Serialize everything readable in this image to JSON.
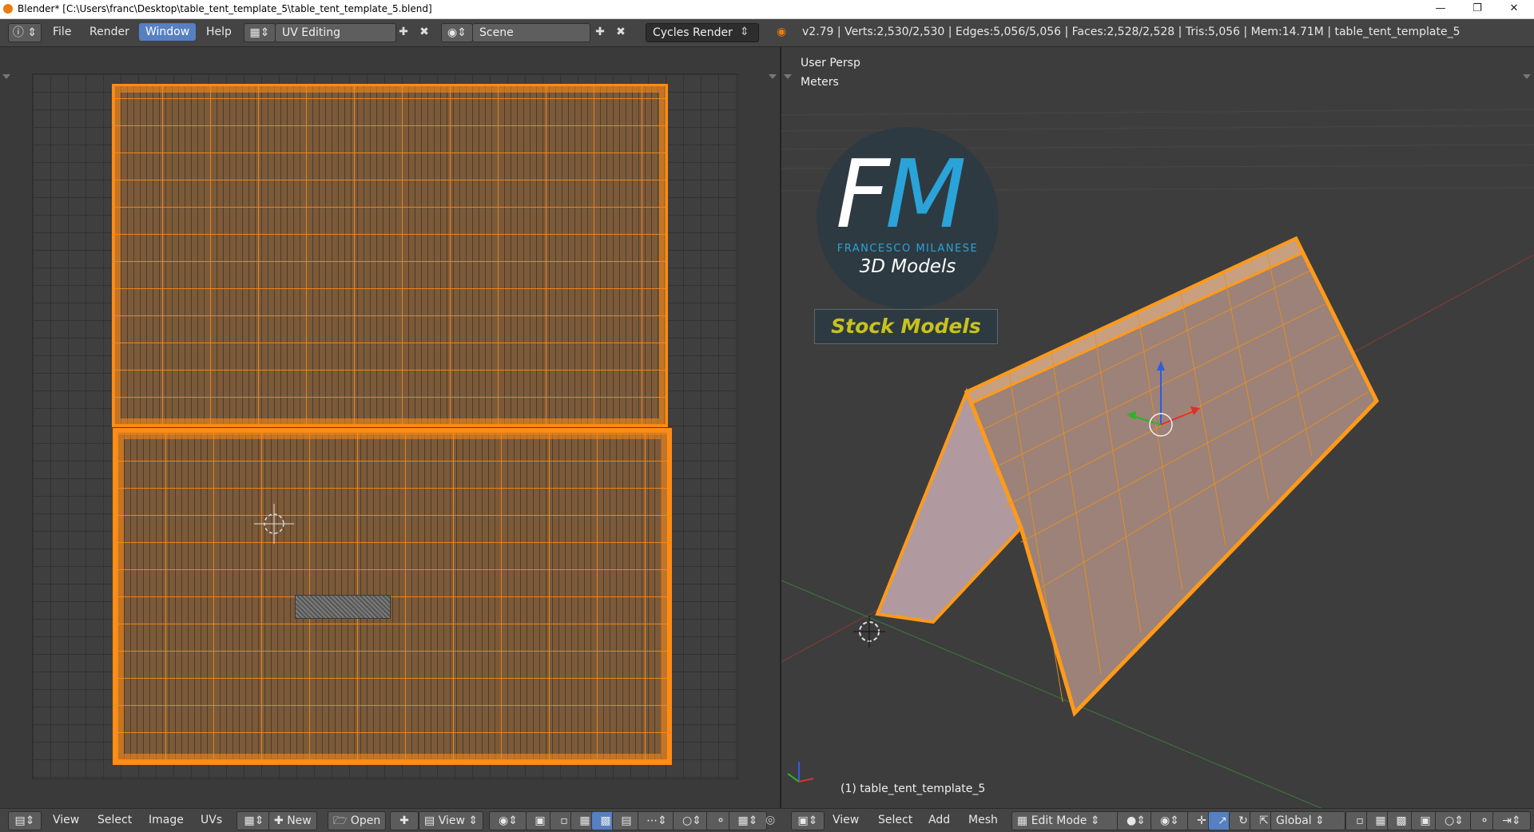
{
  "window": {
    "title": "Blender* [C:\\Users\\franc\\Desktop\\table_tent_template_5\\table_tent_template_5.blend]",
    "minimize_icon": "minimize-icon",
    "maximize_icon": "restore-icon",
    "close_icon": "close-icon"
  },
  "infobar": {
    "menus": [
      "File",
      "Render",
      "Window",
      "Help"
    ],
    "active_menu": "Window",
    "screen_layout": "UV Editing",
    "scene": "Scene",
    "render_engine": "Cycles Render",
    "stats": "v2.79 | Verts:2,530/2,530 | Edges:5,056/5,056 | Faces:2,528/2,528 | Tris:5,056 | Mem:14.71M | table_tent_template_5"
  },
  "viewport": {
    "view_name": "User Persp",
    "units": "Meters",
    "object_label": "(1) table_tent_template_5"
  },
  "logo": {
    "initial_f": "F",
    "initial_m": "M",
    "name": "FRANCESCO MILANESE",
    "subtitle": "3D Models",
    "banner": "Stock Models"
  },
  "uv_header": {
    "menus": [
      "View",
      "Select",
      "Image",
      "UVs"
    ],
    "new_label": "New",
    "open_label": "Open",
    "view_label": "View"
  },
  "view3d_header": {
    "menus": [
      "View",
      "Select",
      "Add",
      "Mesh"
    ],
    "mode": "Edit Mode",
    "orientation": "Global"
  },
  "colors": {
    "selection_orange": "#ff8c14",
    "active_menu_blue": "#5680c2",
    "logo_blue": "#2aa3d8",
    "banner_yellow": "#c8c21e"
  }
}
